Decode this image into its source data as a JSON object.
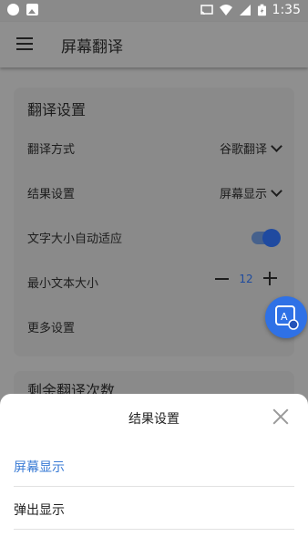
{
  "status_bar": {
    "time": "1:35",
    "left_icons": [
      "notification-dot-icon",
      "image-icon"
    ],
    "right_icons": [
      "cast-icon",
      "wifi-icon",
      "signal-icon",
      "battery-icon"
    ]
  },
  "toolbar": {
    "title": "屏幕翻译",
    "menu_icon": "hamburger-icon"
  },
  "settings_card": {
    "title": "翻译设置",
    "rows": [
      {
        "label": "翻译方式",
        "value": "谷歌翻译",
        "control": "dropdown"
      },
      {
        "label": "结果设置",
        "value": "屏幕显示",
        "control": "dropdown"
      },
      {
        "label": "文字大小自动适应",
        "control": "toggle",
        "on": true
      },
      {
        "label": "最小文本大小",
        "control": "stepper",
        "value": "12"
      },
      {
        "label": "更多设置",
        "control": "link"
      }
    ]
  },
  "remaining_card": {
    "title": "剩余翻译次数"
  },
  "fab": {
    "icon": "translate-icon"
  },
  "bottom_sheet": {
    "title": "结果设置",
    "close_icon": "close-icon",
    "options": [
      {
        "label": "屏幕显示",
        "selected": true
      },
      {
        "label": "弹出显示",
        "selected": false
      }
    ]
  },
  "colors": {
    "accent": "#3a7bd5",
    "selected_text": "#3a7bd5",
    "normal_text": "#222222"
  }
}
